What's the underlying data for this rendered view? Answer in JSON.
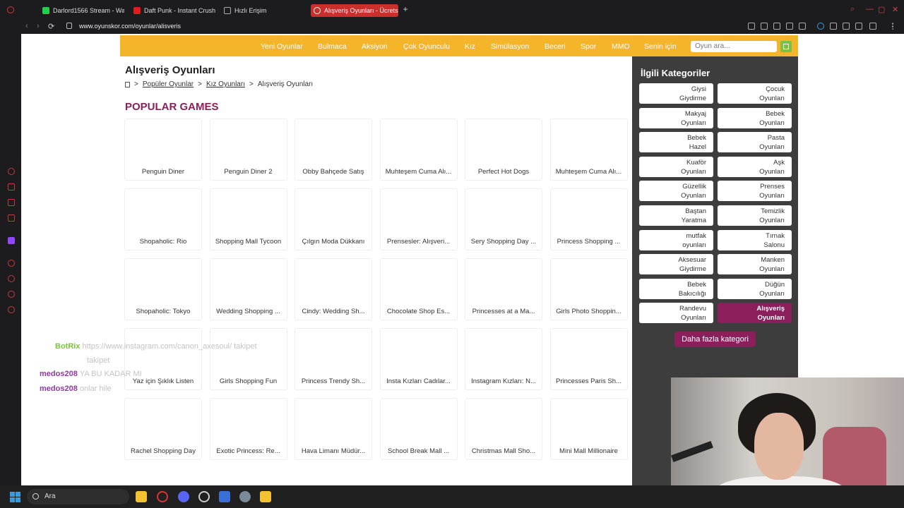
{
  "browser": {
    "tabs": [
      {
        "label": "Darlord1566 Stream - Wat",
        "color": "#1fd14b"
      },
      {
        "label": "Daft Punk - Instant Crush",
        "color": "#e21c1c"
      },
      {
        "label": "Hızlı Erişim",
        "color": "#888888"
      },
      {
        "label": "Alışveriş Oyunları - Ücrets",
        "color": "#ffffff",
        "active": true
      }
    ],
    "url": "www.oyunskor.com/oyunlar/alisveris"
  },
  "nav": {
    "items": [
      "Yeni Oyunlar",
      "Bulmaca",
      "Aksiyon",
      "Çok Oyunculu",
      "Kız",
      "Simülasyon",
      "Beceri",
      "Spor",
      "MMO",
      "Senin için"
    ],
    "search_placeholder": "Oyun ara..."
  },
  "page": {
    "title": "Alışveriş Oyunları",
    "breadcrumb": [
      "Popüler Oyunlar",
      "Kız Oyunları",
      "Alışveriş Oyunları"
    ],
    "section_title": "POPULAR GAMES"
  },
  "games": [
    "Penguin Diner",
    "Penguin Diner 2",
    "Obby Bahçede Satış",
    "Muhteşem Cuma Alı...",
    "Perfect Hot Dogs",
    "Muhteşem Cuma Alı...",
    "Shopaholic: Rio",
    "Shopping Mall Tycoon",
    "Çılgın Moda Dükkanı",
    "Prensesler: Alışveri...",
    "Sery Shopping Day ...",
    "Princess Shopping ...",
    "Shopaholic: Tokyo",
    "Wedding Shopping ...",
    "Cindy: Wedding Sh...",
    "Chocolate Shop Es...",
    "Princesses at a Ma...",
    "Girls Photo Shoppin...",
    "Yaz için Şıklık Listen",
    "Girls Shopping Fun",
    "Princess Trendy Sh...",
    "Insta Kızları Cadılar...",
    "Instagram Kızları: N...",
    "Princesses Paris Sh...",
    "Rachel Shopping Day",
    "Exotic Princess: Re...",
    "Hava Limanı Müdür...",
    "School Break Mall ...",
    "Christmas Mall Sho...",
    "Mini Mall Millionaire"
  ],
  "related": {
    "title": "İlgili Kategoriler",
    "categories": [
      [
        "Giysi",
        "Giydirme"
      ],
      [
        "Çocuk",
        "Oyunları"
      ],
      [
        "Makyaj",
        "Oyunları"
      ],
      [
        "Bebek",
        "Oyunları"
      ],
      [
        "Bebek",
        "Hazel"
      ],
      [
        "Pasta",
        "Oyunları"
      ],
      [
        "Kuaför",
        "Oyunları"
      ],
      [
        "Aşk",
        "Oyunları"
      ],
      [
        "Güzellik",
        "Oyunları"
      ],
      [
        "Prenses",
        "Oyunları"
      ],
      [
        "Baştan",
        "Yaratma"
      ],
      [
        "Temizlik",
        "Oyunları"
      ],
      [
        "mutfak",
        "oyunları"
      ],
      [
        "Tırnak",
        "Salonu"
      ],
      [
        "Aksesuar",
        "Giydirme"
      ],
      [
        "Manken",
        "Oyunları"
      ],
      [
        "Bebek",
        "Bakıcılığı"
      ],
      [
        "Düğün",
        "Oyunları"
      ],
      [
        "Randevu",
        "Oyunları"
      ],
      [
        "Alışveriş",
        "Oyunları"
      ]
    ],
    "selected_index": 19,
    "more_label": "Daha fazla kategori"
  },
  "chat": [
    {
      "user": "BotRix",
      "color": "#7cc242",
      "msg": "https://www.instagram.com/canon_axesoul/ takipet",
      "msg2": "takipet"
    },
    {
      "user": "medos208",
      "color": "#8e3aa0",
      "msg": "YA BU KADAR MI"
    },
    {
      "user": "medos208",
      "color": "#8e3aa0",
      "msg": "onlar hile"
    }
  ],
  "taskbar": {
    "search_label": "Ara"
  }
}
